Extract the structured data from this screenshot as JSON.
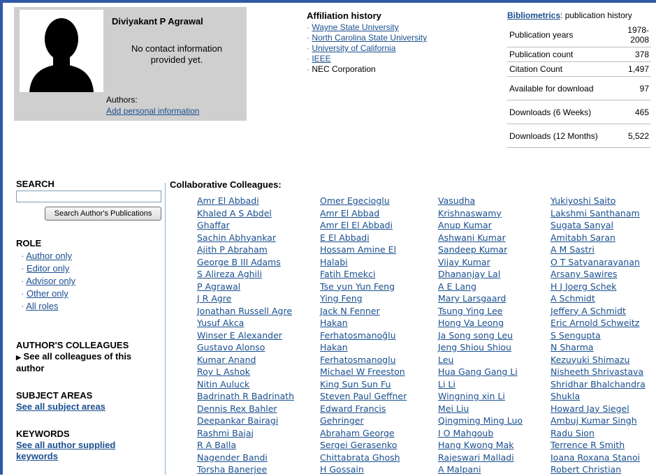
{
  "profile": {
    "name": "Diviyakant P Agrawal",
    "contact_text": "No contact information provided yet.",
    "authors_label": "Authors:",
    "add_info_link": "Add personal information"
  },
  "affiliation": {
    "title": "Affiliation history",
    "items": [
      {
        "label": "Wayne State University",
        "link": true
      },
      {
        "label": "North Carolina State University",
        "link": true
      },
      {
        "label": "University of California",
        "link": true
      },
      {
        "label": "IEEE",
        "link": true
      },
      {
        "label": "NEC Corporation",
        "link": false
      }
    ]
  },
  "bibliometrics": {
    "link": "Bibliometrics",
    "suffix": ": publication history",
    "rows": [
      {
        "label": "Publication years",
        "value": "1978-2008"
      },
      {
        "label": "Publication count",
        "value": "378"
      },
      {
        "label": "Citation Count",
        "value": "1,497"
      },
      {
        "label": "Available for download",
        "value": "97"
      },
      {
        "label": "Downloads (6 Weeks)",
        "value": "465"
      },
      {
        "label": "Downloads (12 Months)",
        "value": "5,522"
      }
    ]
  },
  "search": {
    "heading": "SEARCH",
    "input_value": "",
    "button_label": "Search Author's Publications"
  },
  "role": {
    "heading": "ROLE",
    "items": [
      "Author only",
      "Editor only",
      "Advisor only",
      "Other only",
      "All roles"
    ]
  },
  "colleagues_section": {
    "heading": "AUTHOR'S COLLEAGUES",
    "link": "See all colleagues of this author"
  },
  "subject_section": {
    "heading": "SUBJECT AREAS",
    "link": "See all subject areas"
  },
  "keywords_section": {
    "heading": "KEYWORDS",
    "link": "See all author supplied keywords"
  },
  "collab": {
    "title": "Collaborative Colleagues:",
    "columns": [
      [
        "Amr El Abbadi",
        "Khaled A S Abdel",
        "Ghaffar",
        "Sachin Abhyankar",
        "Ajith P Abraham",
        "George B III Adams",
        "S Alireza Aghili",
        "P Agrawal",
        "J R Agre",
        "Jonathan Russell Agre",
        "Yusuf Akca",
        "Winser E Alexander",
        "Gustavo Alonso",
        "Kumar Anand",
        "Roy L Ashok",
        "Nitin Auluck",
        "Badrinath R Badrinath",
        "Dennis Rex Bahler",
        "Deepankar Bairagi",
        "Rashmi Bajaj",
        "R A Balla",
        "Nagender Bandi",
        "Torsha Banerjee"
      ],
      [
        "Omer Egecioglu",
        "Amr El Abbad",
        "Amr El El Abbadi",
        "E El Abbadi",
        "Hossam Amine El",
        "Halabi",
        "Fatih Emekci",
        "Tse yun Yun Feng",
        "Ying Feng",
        "Jack N Fenner",
        "Hakan",
        "Ferhatosmanoğlu",
        "Hakan",
        "Ferhatosmanoglu",
        "Michael W Freeston",
        "King Sun Sun Fu",
        "Steven Paul Geffner",
        "Edward Francis",
        "Gehringer",
        "Abraham George",
        "Sergei Gerasenko",
        "Chittabrata Ghosh",
        "H Gossain"
      ],
      [
        "Vasudha",
        "Krishnaswamy",
        "Anup Kumar",
        "Ashwani Kumar",
        "Sandeep Kumar",
        "Vijay Kumar",
        "Dhananjay Lal",
        "A E Lang",
        "Mary Larsgaard",
        "Tsung Ying Lee",
        "Hong Va Leong",
        "Ja Song song Leu",
        "Jeng Shiou Shiou",
        "Leu",
        "Hua Gang Gang Li",
        "Li Li",
        "Wingning xin Li",
        "Mei Liu",
        "Qingming Ming Luo",
        "I O Mahgoub",
        "Hang Kwong Mak",
        "Rajeswari Malladi",
        "A Malpani"
      ],
      [
        "Yukiyoshi Saito",
        "Lakshmi Santhanam",
        "Sugata Sanyal",
        "Amitabh Saran",
        "A M Sastri",
        "O T Satyanarayanan",
        "Arsany Sawires",
        "H J Joerg Schek",
        "A Schmidt",
        "Jeffery A Schmidt",
        "Eric Arnold Schweitz",
        "S Sengupta",
        "N Sharma",
        "Kezuyuki Shimazu",
        "Nisheeth Shrivastava",
        "Shridhar Bhalchandra",
        "Shukla",
        "Howard Jay Siegel",
        "Ambuj Kumar Singh",
        "Radu Sion",
        "Terrence R Smith",
        "Ioana Roxana Stanoi",
        "Robert Christian"
      ]
    ]
  }
}
